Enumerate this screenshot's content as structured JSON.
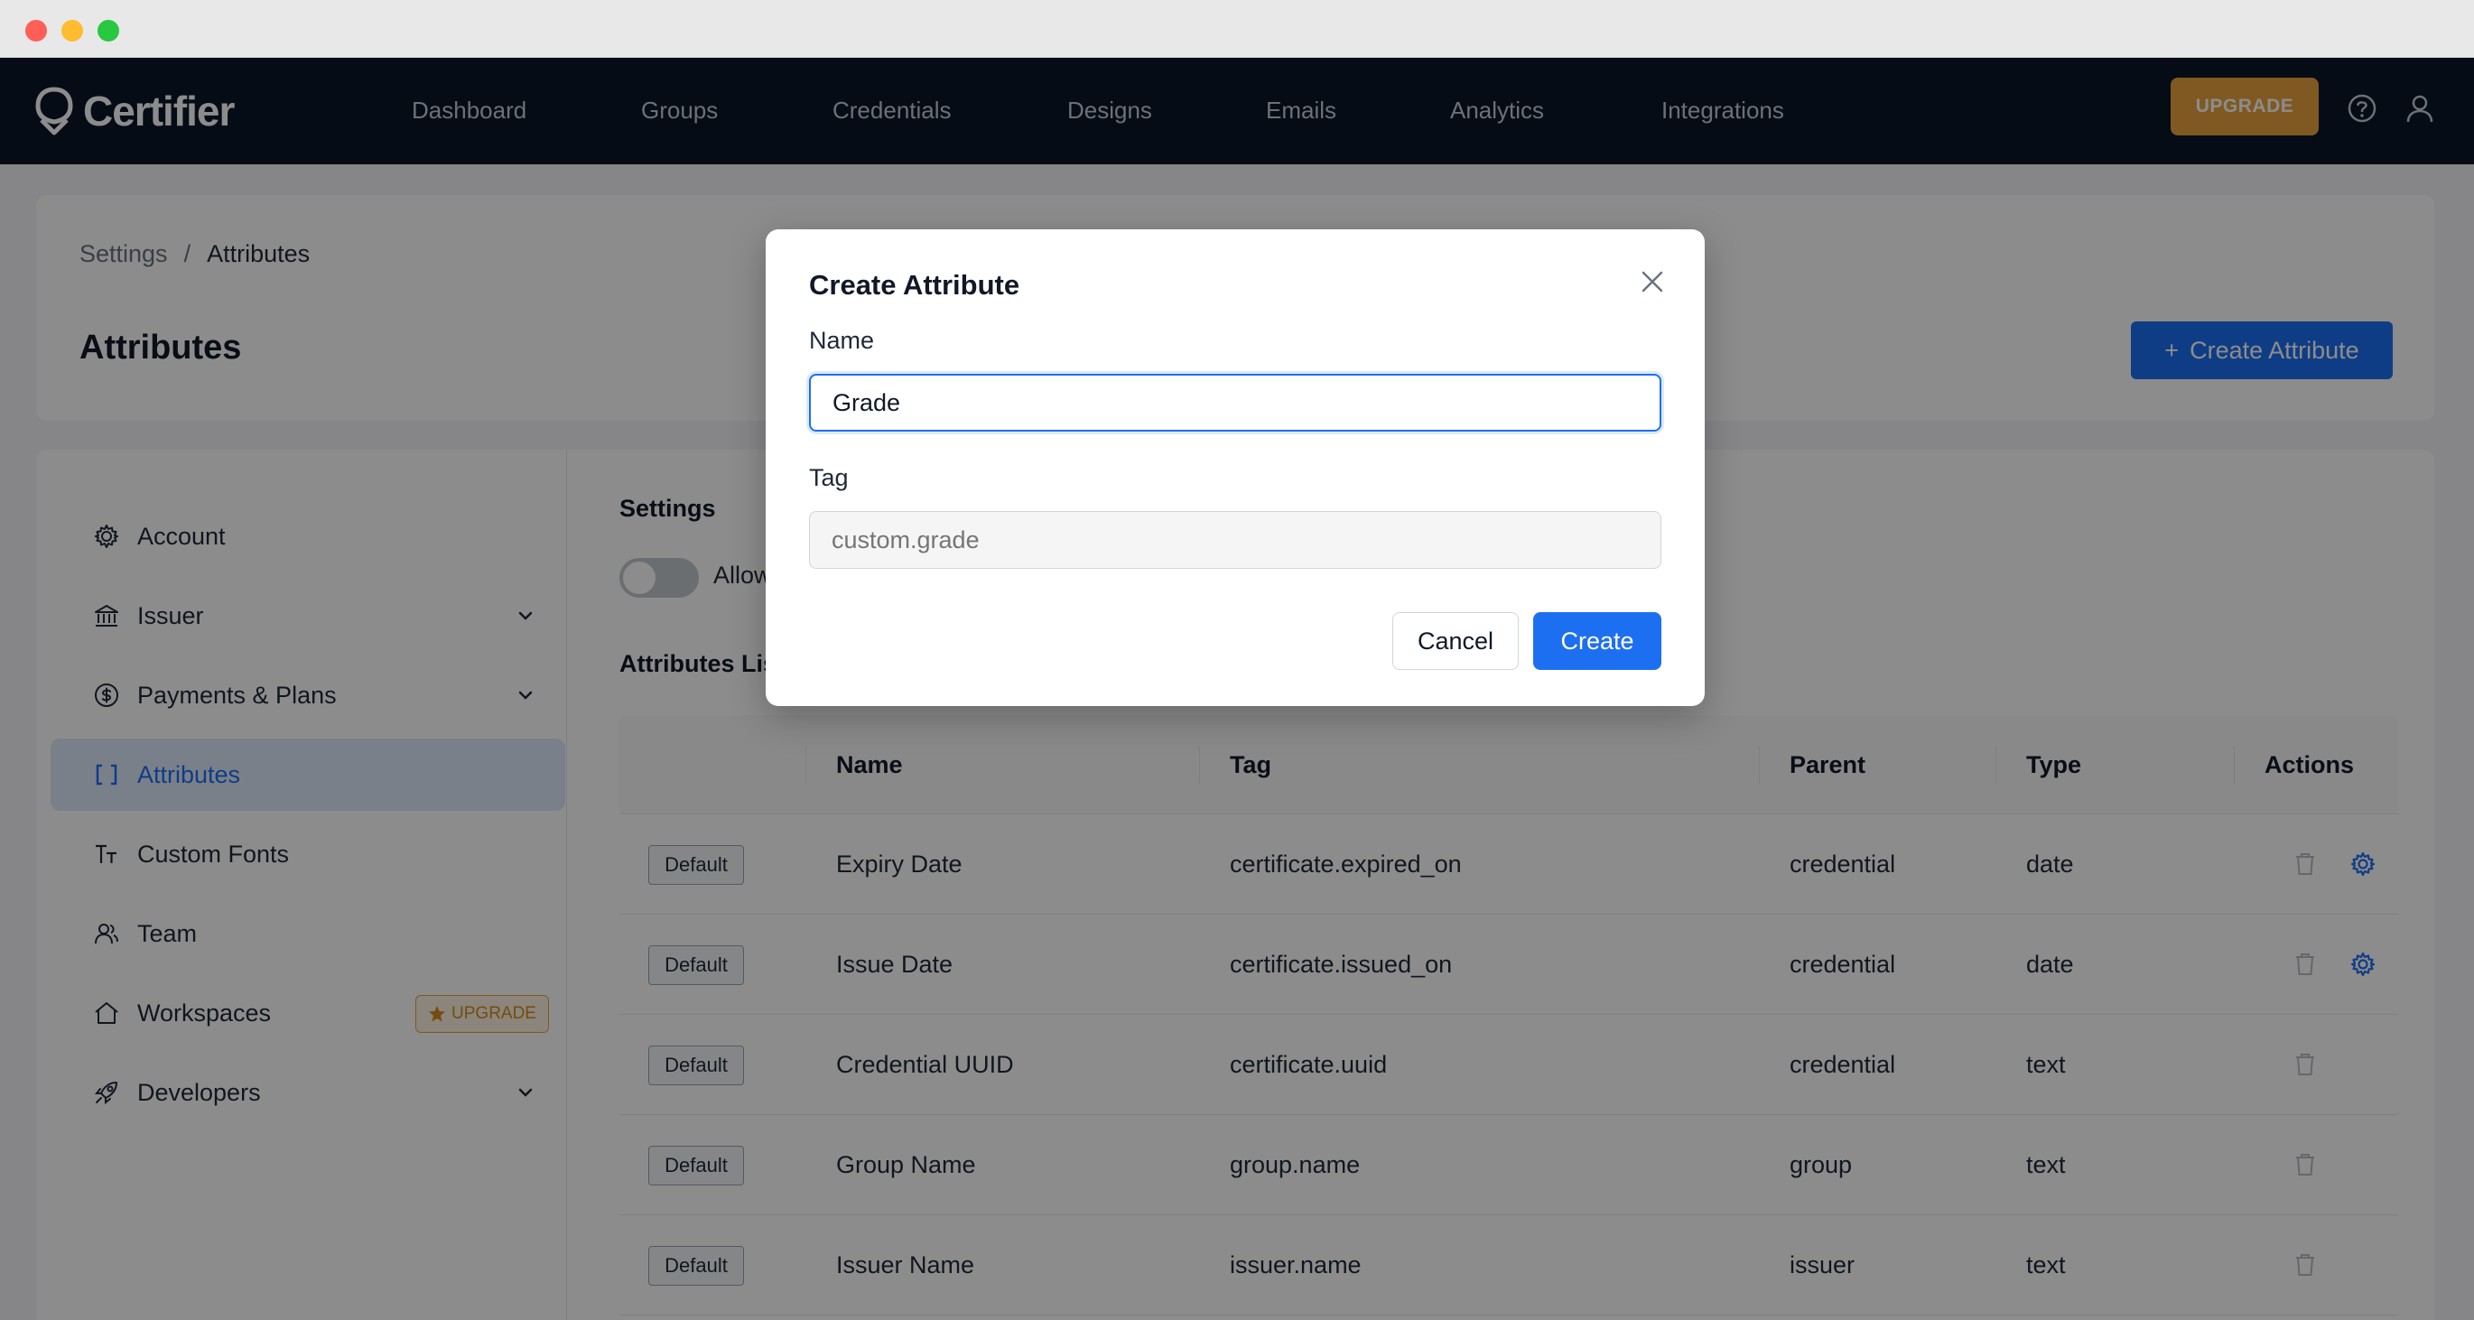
{
  "brand": {
    "name": "Certifier"
  },
  "nav": {
    "links": [
      "Dashboard",
      "Groups",
      "Credentials",
      "Designs",
      "Emails",
      "Analytics",
      "Integrations"
    ],
    "upgrade_label": "UPGRADE"
  },
  "breadcrumb": {
    "parent": "Settings",
    "separator": "/",
    "current": "Attributes"
  },
  "page": {
    "title": "Attributes",
    "create_button": "Create Attribute"
  },
  "sidebar": {
    "items": [
      {
        "label": "Account",
        "icon": "gear-icon"
      },
      {
        "label": "Issuer",
        "icon": "bank-icon"
      },
      {
        "label": "Payments & Plans",
        "icon": "dollar-icon"
      },
      {
        "label": "Attributes",
        "icon": "brackets-icon"
      },
      {
        "label": "Custom Fonts",
        "icon": "font-icon"
      },
      {
        "label": "Team",
        "icon": "team-icon"
      },
      {
        "label": "Workspaces",
        "icon": "home-icon"
      },
      {
        "label": "Developers",
        "icon": "rocket-icon"
      }
    ],
    "workspaces_badge": "UPGRADE"
  },
  "settings": {
    "label": "Settings",
    "toggle_label": "Allow"
  },
  "attributes_list": {
    "label": "Attributes Lis",
    "columns": [
      "Name",
      "Tag",
      "Parent",
      "Type",
      "Actions"
    ],
    "default_badge": "Default",
    "rows": [
      {
        "name": "Expiry Date",
        "tag": "certificate.expired_on",
        "parent": "credential",
        "type": "date"
      },
      {
        "name": "Issue Date",
        "tag": "certificate.issued_on",
        "parent": "credential",
        "type": "date"
      },
      {
        "name": "Credential UUID",
        "tag": "certificate.uuid",
        "parent": "credential",
        "type": "text"
      },
      {
        "name": "Group Name",
        "tag": "group.name",
        "parent": "group",
        "type": "text"
      },
      {
        "name": "Issuer Name",
        "tag": "issuer.name",
        "parent": "issuer",
        "type": "text"
      }
    ]
  },
  "modal": {
    "title": "Create Attribute",
    "name_label": "Name",
    "name_value": "Grade",
    "tag_label": "Tag",
    "tag_placeholder": "custom.grade",
    "cancel_label": "Cancel",
    "create_label": "Create"
  },
  "colors": {
    "accent": "#1d6ff2",
    "upgrade": "#e8a33d",
    "nav_bg": "#0a1628"
  }
}
